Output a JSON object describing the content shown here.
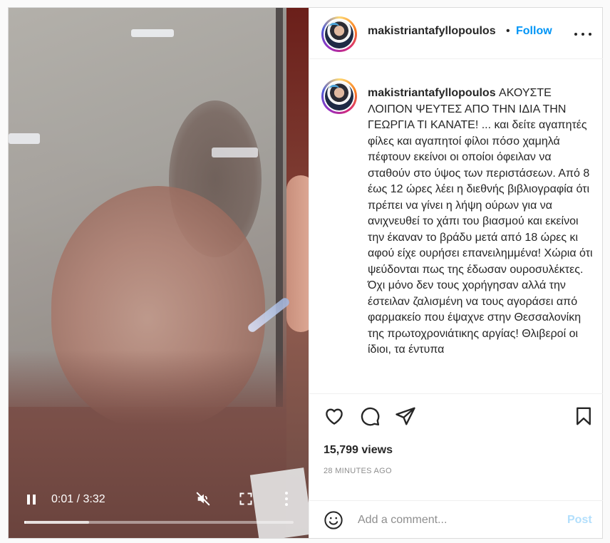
{
  "video": {
    "time_display": "0:01 / 3:32",
    "progress_fraction": 0.005,
    "buffer_fraction": 0.24,
    "icons": {
      "pause": "pause-icon",
      "mute": "mute-icon",
      "fullscreen": "fullscreen-icon",
      "more": "more-vertical-icon"
    }
  },
  "header": {
    "username": "makistriantafyllopoulos",
    "separator": "•",
    "follow_label": "Follow",
    "more_icon": "more-horizontal-icon"
  },
  "caption": {
    "username": "makistriantafyllopoulos",
    "text": " ΑΚΟΥΣΤΕ ΛΟΙΠΟΝ ΨΕΥΤΕΣ ΑΠΟ ΤΗΝ ΙΔΙΑ ΤΗΝ ΓΕΩΡΓΙΑ ΤΙ ΚΑΝΑΤΕ! ... και δείτε αγαπητές φίλες και αγαπητοί φίλοι πόσο χαμηλά πέφτουν εκείνοι οι οποίοι όφειλαν να σταθούν στο ύψος των περιστάσεων. Από 8 έως 12 ώρες λέει η διεθνής βιβλιογραφία ότι πρέπει να γίνει η λήψη ούρων για να ανιχνευθεί το χάπι του βιασμού και εκείνοι την έκαναν το βράδυ μετά από 18 ώρες κι αφού είχε ουρήσει επανειλημμένα! Χώρια ότι ψεύδονται πως της έδωσαν ουροσυλέκτες. Όχι μόνο δεν τους χορήγησαν αλλά την έστειλαν ζαλισμένη να τους αγοράσει από φαρμακείο που έψαχνε στην Θεσσαλονίκη της πρωτοχρονιάτικης αργίας! Θλιβεροί οι ίδιοι, τα έντυπα"
  },
  "actions": {
    "icons": [
      "heart-icon",
      "comment-icon",
      "share-icon",
      "bookmark-icon"
    ],
    "views": "15,799 views",
    "time_ago": "28 MINUTES AGO"
  },
  "comment_box": {
    "emoji_icon": "emoji-icon",
    "placeholder": "Add a comment...",
    "post_label": "Post"
  },
  "colors": {
    "follow_blue": "#0095f6",
    "post_disabled": "#b2dffc",
    "border": "#dbdbdb",
    "secondary_text": "#8e8e8e"
  }
}
